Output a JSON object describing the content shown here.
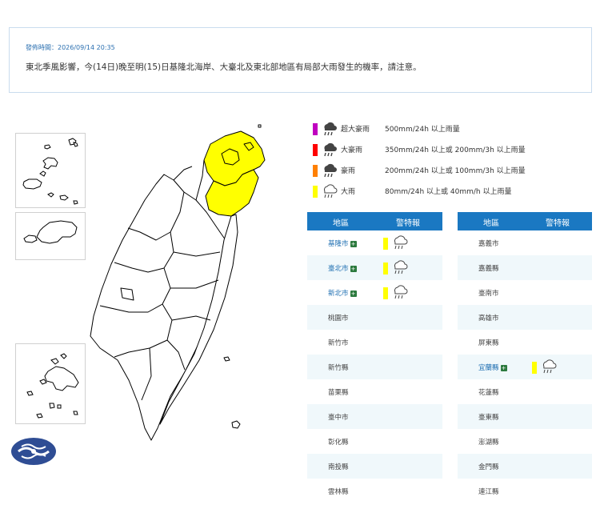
{
  "notice": {
    "time": "發佈時間：2026/09/14 20:35",
    "text": "東北季風影響，今(14日)晚至明(15)日基隆北海岸、大臺北及東北部地區有局部大雨發生的機率，請注意。"
  },
  "colors": {
    "super_torrential": "#c000c0",
    "torrential": "#ff0000",
    "extremely_heavy": "#ff8000",
    "heavy": "#ffff00",
    "header": "#1a78c2",
    "alt_row": "#f0f8fb"
  },
  "legend": [
    {
      "name": "超大豪雨",
      "desc": "500mm/24h 以上雨量",
      "color": "#c000c0",
      "icon": "cloud-heavy-rain-icon"
    },
    {
      "name": "大豪雨",
      "desc": "350mm/24h 以上或 200mm/3h 以上雨量",
      "color": "#ff0000",
      "icon": "cloud-heavy-rain-icon"
    },
    {
      "name": "豪雨",
      "desc": "200mm/24h 以上或 100mm/3h 以上雨量",
      "color": "#ff8000",
      "icon": "cloud-heavy-rain-icon"
    },
    {
      "name": "大雨",
      "desc": "80mm/24h 以上或 40mm/h 以上雨量",
      "color": "#ffff00",
      "icon": "cloud-rain-icon"
    }
  ],
  "table_left": {
    "col_area": "地區",
    "col_warning": "警特報",
    "rows": [
      {
        "name": "基隆市",
        "warned": true
      },
      {
        "name": "臺北市",
        "warned": true
      },
      {
        "name": "新北市",
        "warned": true
      },
      {
        "name": "桃園市",
        "warned": false
      },
      {
        "name": "新竹市",
        "warned": false
      },
      {
        "name": "新竹縣",
        "warned": false
      },
      {
        "name": "苗栗縣",
        "warned": false
      },
      {
        "name": "臺中市",
        "warned": false
      },
      {
        "name": "彰化縣",
        "warned": false
      },
      {
        "name": "南投縣",
        "warned": false
      },
      {
        "name": "雲林縣",
        "warned": false
      }
    ]
  },
  "table_right": {
    "col_area": "地區",
    "col_warning": "警特報",
    "rows": [
      {
        "name": "嘉義市",
        "warned": false
      },
      {
        "name": "嘉義縣",
        "warned": false
      },
      {
        "name": "臺南市",
        "warned": false
      },
      {
        "name": "高雄市",
        "warned": false
      },
      {
        "name": "屏東縣",
        "warned": false
      },
      {
        "name": "宜蘭縣",
        "warned": true
      },
      {
        "name": "花蓮縣",
        "warned": false
      },
      {
        "name": "臺東縣",
        "warned": false
      },
      {
        "name": "澎湖縣",
        "warned": false
      },
      {
        "name": "金門縣",
        "warned": false
      },
      {
        "name": "連江縣",
        "warned": false
      }
    ]
  },
  "map": {
    "highlight_color": "#ffff00",
    "highlighted_regions": [
      "基隆市",
      "臺北市",
      "新北市",
      "宜蘭縣"
    ]
  }
}
